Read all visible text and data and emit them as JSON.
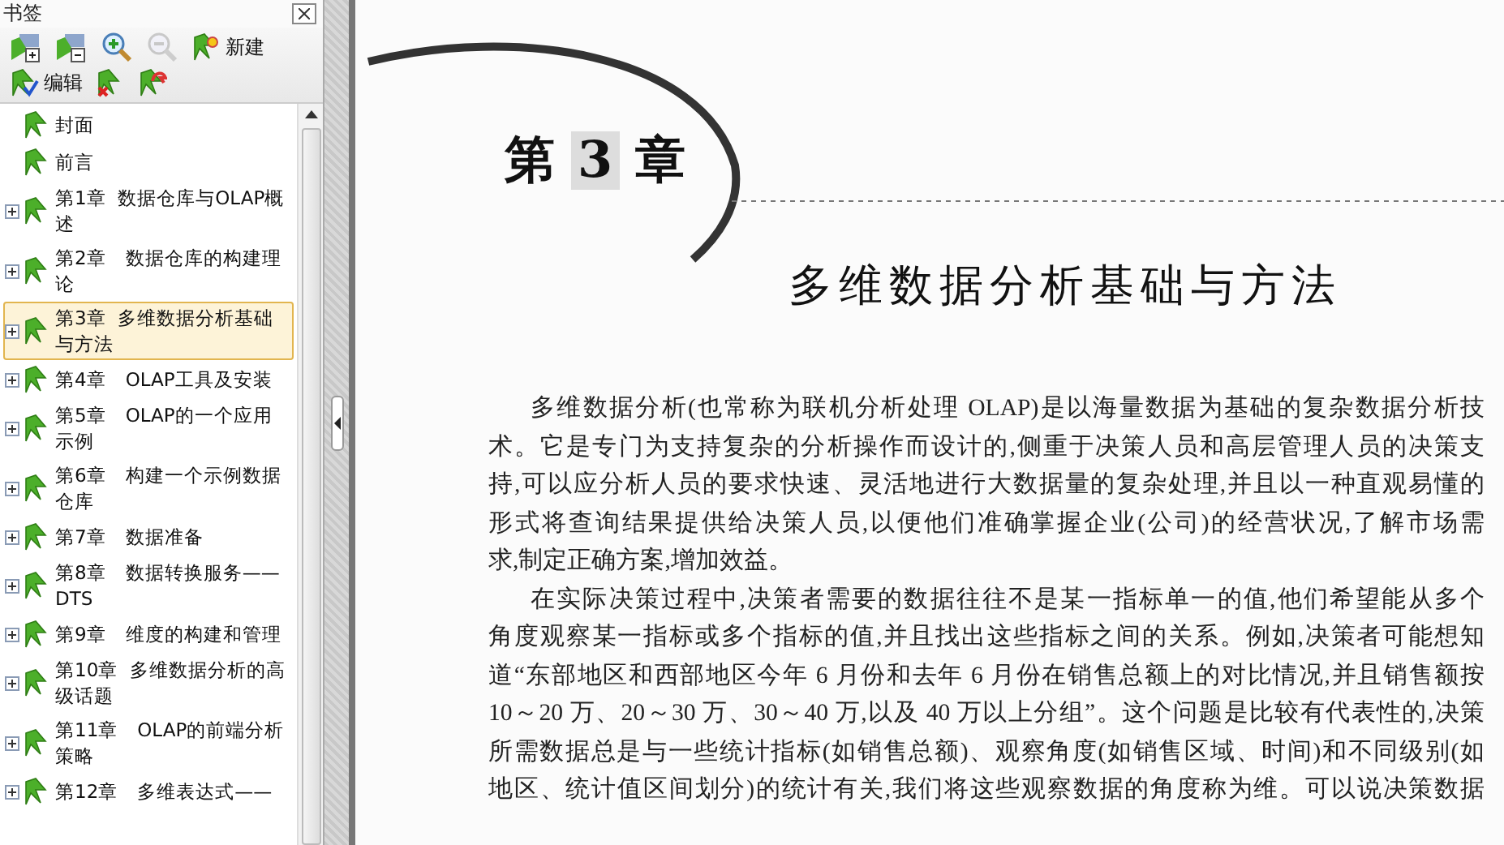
{
  "bookmarks": {
    "title": "书签",
    "toolbar": [
      {
        "kind": "expand-all",
        "disabled": false
      },
      {
        "kind": "collapse-all",
        "disabled": false
      },
      {
        "kind": "zoom-in",
        "disabled": false
      },
      {
        "kind": "zoom-out",
        "disabled": true
      },
      {
        "kind": "new",
        "label": "新建",
        "disabled": false
      },
      {
        "kind": "edit",
        "label": "编辑",
        "disabled": false
      },
      {
        "kind": "delete",
        "disabled": false
      },
      {
        "kind": "goto",
        "disabled": false
      }
    ],
    "items": [
      {
        "label": "封面",
        "expandable": false,
        "selected": false
      },
      {
        "label": "前言",
        "expandable": false,
        "selected": false
      },
      {
        "label": "第1章  数据仓库与OLAP概述",
        "expandable": true,
        "selected": false
      },
      {
        "label": "第2章　数据仓库的构建理论",
        "expandable": true,
        "selected": false
      },
      {
        "label": "第3章  多维数据分析基础与方法",
        "expandable": true,
        "selected": true
      },
      {
        "label": "第4章　OLAP工具及安装",
        "expandable": true,
        "selected": false
      },
      {
        "label": "第5章　OLAP的一个应用示例",
        "expandable": true,
        "selected": false
      },
      {
        "label": "第6章　构建一个示例数据仓库",
        "expandable": true,
        "selected": false
      },
      {
        "label": "第7章　数据准备",
        "expandable": true,
        "selected": false
      },
      {
        "label": "第8章　数据转换服务——DTS",
        "expandable": true,
        "selected": false
      },
      {
        "label": "第9章　维度的构建和管理",
        "expandable": true,
        "selected": false
      },
      {
        "label": "第10章  多维数据分析的高级话题",
        "expandable": true,
        "selected": false
      },
      {
        "label": "第11章　OLAP的前端分析策略",
        "expandable": true,
        "selected": false
      },
      {
        "label": "第12章　多维表达式——",
        "expandable": true,
        "selected": false
      }
    ]
  },
  "page": {
    "chapter": {
      "prefix": "第",
      "number": "3",
      "suffix": "章"
    },
    "title": "多维数据分析基础与方法",
    "paragraphs": [
      [
        "多维数据分析(也常称为联机分析处理 OLAP)是以海量数据为基础的复杂数据分析技",
        "术。它是专门为支持复杂的分析操作而设计的,侧重于决策人员和高层管理人员的决策支",
        "持,可以应分析人员的要求快速、灵活地进行大数据量的复杂处理,并且以一种直观易懂的",
        "形式将查询结果提供给决策人员,以便他们准确掌握企业(公司)的经营状况,了解市场需",
        "求,制定正确方案,增加效益。"
      ],
      [
        "在实际决策过程中,决策者需要的数据往往不是某一指标单一的值,他们希望能从多个",
        "角度观察某一指标或多个指标的值,并且找出这些指标之间的关系。例如,决策者可能想知",
        "道“东部地区和西部地区今年 6 月份和去年 6 月份在销售总额上的对比情况,并且销售额按",
        "10～20 万、20～30 万、30～40 万,以及 40 万以上分组”。这个问题是比较有代表性的,决策",
        "所需数据总是与一些统计指标(如销售总额)、观察角度(如销售区域、时间)和不同级别(如",
        "地区、统计值区间划分)的统计有关,我们将这些观察数据的角度称为维。可以说决策数据"
      ]
    ]
  }
}
